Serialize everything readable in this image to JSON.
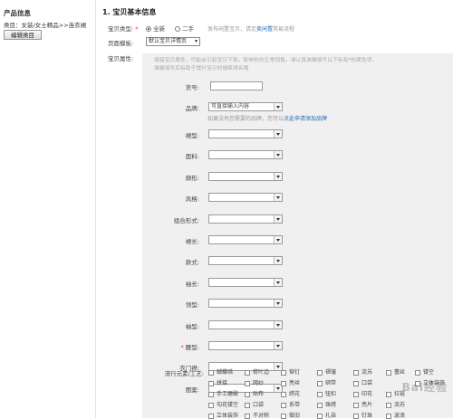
{
  "sidebar": {
    "title": "产品信息",
    "category": "类目：女装/女士精品>>连衣裙",
    "edit_button": "编辑类目"
  },
  "section": {
    "title": "1. 宝贝基本信息",
    "type_label": "宝贝类型:",
    "type_options": [
      "全新",
      "二手"
    ],
    "type_hint_prefix": "发布闲置宝贝，请走",
    "type_hint_link": "卖闲置",
    "type_hint_suffix": "简易流程",
    "template_label": "页面模板:",
    "template_value": "默认宝贝详情页",
    "attr_label": "宝贝属性:"
  },
  "panel": {
    "hint": "填错宝贝属性，可能会引起宝贝下架，影响你的正常销售。请认真准确填写以下标有*的属性项，准确填写后有助于提升宝贝的搜索排名哦",
    "huohao_label": "货号:",
    "brand_label": "品牌:",
    "brand_value": "可直接输入内容",
    "brand_hint_prefix": "如果没有您需要的品牌，您可以",
    "brand_hint_link": "点此申请添加品牌",
    "fields": [
      {
        "label": "裙型:",
        "required": false
      },
      {
        "label": "面料:",
        "required": false
      },
      {
        "label": "廓形:",
        "required": false
      },
      {
        "label": "风格:",
        "required": false
      },
      {
        "label": "组合形式:",
        "required": false
      },
      {
        "label": "裙长:",
        "required": false
      },
      {
        "label": "款式:",
        "required": false
      },
      {
        "label": "袖长:",
        "required": false
      },
      {
        "label": "领型:",
        "required": false
      },
      {
        "label": "袖型:",
        "required": false
      },
      {
        "label": "腰型:",
        "required": true
      },
      {
        "label": "衣门襟:",
        "required": false
      },
      {
        "label": "图案:",
        "required": false
      }
    ],
    "elements_label": "流行元素/工艺:",
    "elements": [
      [
        "蝴蝶结",
        "荷叶边",
        "铆钉",
        "褶皱",
        "流苏",
        "蕾丝",
        "镂空"
      ],
      [
        "拼接",
        "网纱",
        "亮丝",
        "绑带",
        "口袋",
        "",
        "立体装饰"
      ],
      [
        "手工磨破",
        "贴布",
        "绣花",
        "钮扣",
        "印花",
        "拉链",
        ""
      ],
      [
        "勾花镂空",
        "口袋",
        "系带",
        "珠绣",
        "亮片",
        "流苏",
        ""
      ],
      [
        "立体装饰",
        "不对称",
        "做旧",
        "扎染",
        "钉珠",
        "波浪",
        ""
      ]
    ]
  },
  "watermark": "Bai经验"
}
